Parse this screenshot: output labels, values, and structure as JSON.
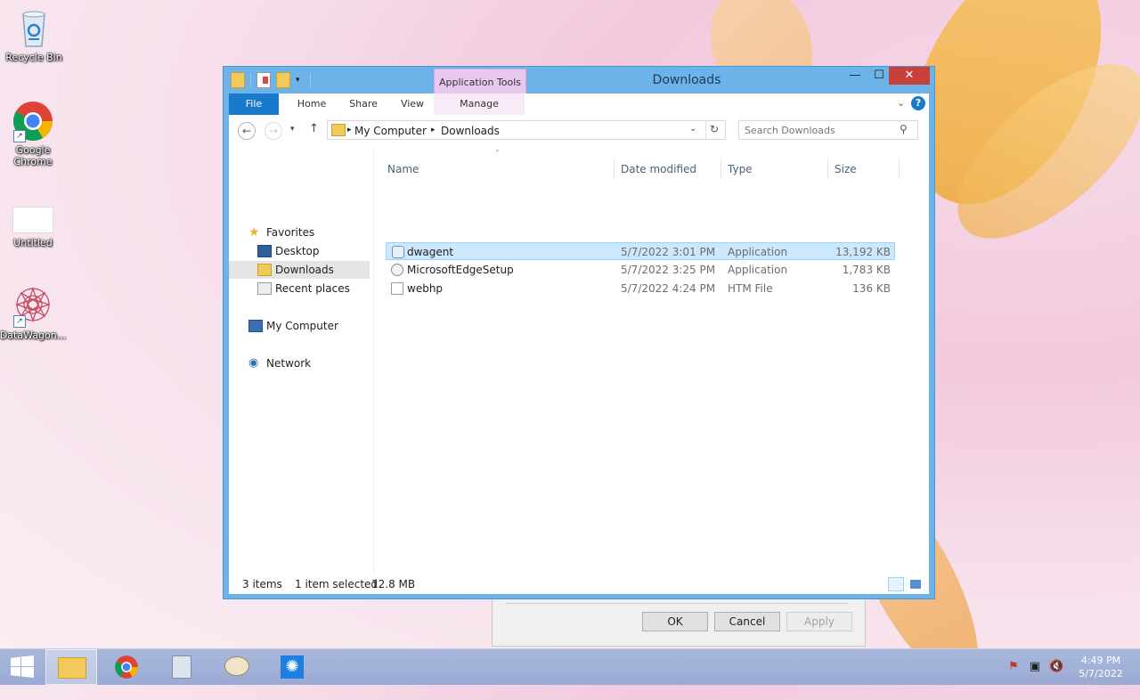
{
  "desktop": {
    "icons": [
      {
        "label": "Recycle Bin"
      },
      {
        "label": "Google\nChrome"
      },
      {
        "label": "Untitled"
      },
      {
        "label": "DataWagon..."
      }
    ]
  },
  "background_dialog": {
    "ok_label": "OK",
    "cancel_label": "Cancel",
    "apply_label": "Apply"
  },
  "window": {
    "title": "Downloads",
    "context_tab_group": "Application Tools",
    "tabs": [
      "File",
      "Home",
      "Share",
      "View",
      "Manage"
    ],
    "minimize_glyph": "—",
    "maximize_glyph": "☐",
    "close_glyph": "✕",
    "address": {
      "crumbs": [
        "My Computer",
        "Downloads"
      ],
      "separator": "▸"
    },
    "search": {
      "placeholder": "Search Downloads"
    },
    "nav": {
      "favorites": "Favorites",
      "desktop": "Desktop",
      "downloads": "Downloads",
      "recent": "Recent places",
      "computer": "My Computer",
      "network": "Network"
    },
    "columns": {
      "name": "Name",
      "date": "Date modified",
      "type": "Type",
      "size": "Size"
    },
    "files": [
      {
        "name": "dwagent",
        "date": "5/7/2022 3:01 PM",
        "type": "Application",
        "size": "13,192 KB",
        "selected": true
      },
      {
        "name": "MicrosoftEdgeSetup",
        "date": "5/7/2022 3:25 PM",
        "type": "Application",
        "size": "1,783 KB",
        "selected": false
      },
      {
        "name": "webhp",
        "date": "5/7/2022 4:24 PM",
        "type": "HTM File",
        "size": "136 KB",
        "selected": false
      }
    ],
    "status": {
      "count": "3 items",
      "selection": "1 item selected",
      "size": "12.8 MB"
    }
  },
  "taskbar": {
    "clock_time": "4:49 PM",
    "clock_date": "5/7/2022"
  },
  "colors": {
    "file_tab": "#1979ca",
    "selection": "#cce8ff",
    "close_button": "#c7403a",
    "window_frame": "#6bb3e8"
  }
}
